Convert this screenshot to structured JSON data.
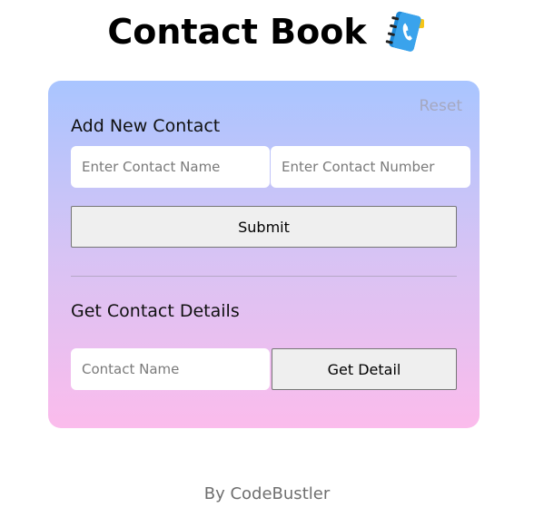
{
  "header": {
    "title": "Contact Book",
    "icon": "contact-book-icon"
  },
  "card": {
    "reset_label": "Reset",
    "add_section": {
      "title": "Add New Contact",
      "name_placeholder": "Enter Contact Name",
      "number_placeholder": "Enter Contact Number",
      "name_value": "",
      "number_value": "",
      "submit_label": "Submit"
    },
    "get_section": {
      "title": "Get Contact Details",
      "name_placeholder": "Contact Name",
      "name_value": "",
      "button_label": "Get Detail"
    }
  },
  "footer": {
    "text": "By CodeBustler"
  },
  "colors": {
    "gradient_top": "#a9c5ff",
    "gradient_mid": "#d7c3f4",
    "gradient_bottom": "#fbbcec",
    "reset_text": "#a5a8c0",
    "button_bg": "#efefef",
    "icon_blue": "#2196d8"
  }
}
